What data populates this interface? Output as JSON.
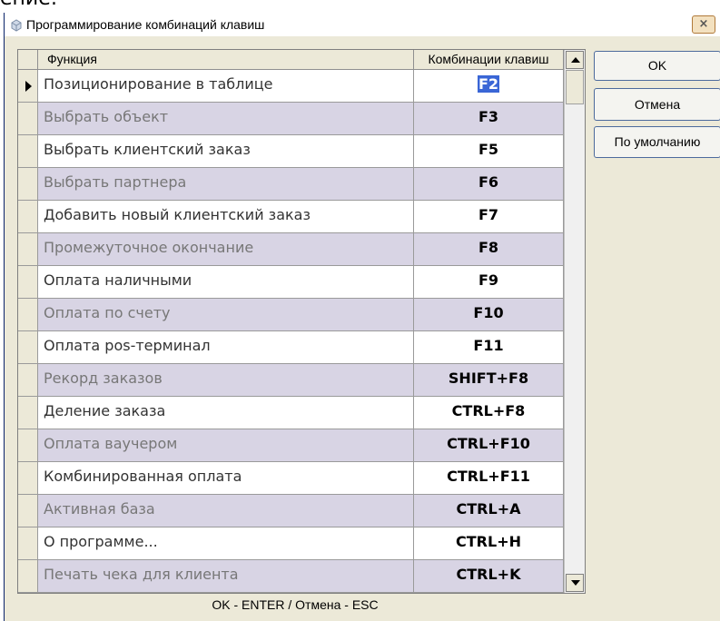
{
  "page_top_fragment": "ение:",
  "window": {
    "title": "Программирование комбинаций клавиш",
    "close_label": "×"
  },
  "grid": {
    "headers": {
      "function": "Функция",
      "keys": "Комбинации клавиш"
    },
    "rows": [
      {
        "function": "Позиционирование в таблице",
        "keys": "F2"
      },
      {
        "function": "Выбрать объект",
        "keys": "F3"
      },
      {
        "function": "Выбрать клиентский заказ",
        "keys": "F5"
      },
      {
        "function": "Выбрать партнера",
        "keys": "F6"
      },
      {
        "function": "Добавить новый клиентский заказ",
        "keys": "F7"
      },
      {
        "function": "Промежуточное окончание",
        "keys": "F8"
      },
      {
        "function": "Оплата наличными",
        "keys": "F9"
      },
      {
        "function": "Оплата по счету",
        "keys": "F10"
      },
      {
        "function": "Оплата pos-терминал",
        "keys": "F11"
      },
      {
        "function": "Рекорд заказов",
        "keys": "SHIFT+F8"
      },
      {
        "function": "Деление заказа",
        "keys": "CTRL+F8"
      },
      {
        "function": "Оплата ваучером",
        "keys": "CTRL+F10"
      },
      {
        "function": "Комбинированная оплата",
        "keys": "CTRL+F11"
      },
      {
        "function": "Активная база",
        "keys": "CTRL+A"
      },
      {
        "function": "О программе...",
        "keys": "CTRL+H"
      },
      {
        "function": "Печать чека для клиента",
        "keys": "CTRL+K"
      }
    ]
  },
  "buttons": {
    "ok": "OK",
    "cancel": "Отмена",
    "default": "По умолчанию"
  },
  "status": "OK - ENTER / Отмена - ESC",
  "colors": {
    "row_alt": "#d8d4e4",
    "selection": "#3a66d6",
    "window_bg": "#ece9d8"
  }
}
